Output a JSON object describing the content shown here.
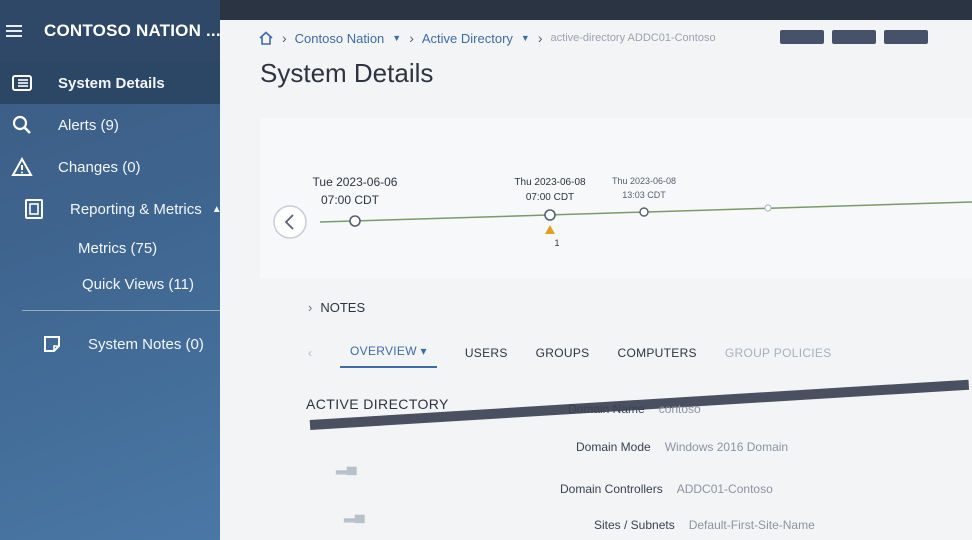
{
  "sidebar": {
    "title": "CONTOSO NATION ...",
    "items": [
      {
        "label": "System Details",
        "icon": "list-icon"
      },
      {
        "label": "Alerts (9)",
        "icon": "search-icon"
      },
      {
        "label": "Changes (0)",
        "icon": "warning-icon"
      },
      {
        "label": "Reporting & Metrics",
        "icon": "report-icon"
      },
      {
        "label": "Metrics (75)"
      },
      {
        "label": "Quick Views (11)"
      },
      {
        "label": "System Notes (0)",
        "icon": "note-icon"
      }
    ]
  },
  "breadcrumb": {
    "level1": "Contoso Nation",
    "level2": "Active Directory",
    "level3": "active-directory ADDC01-Contoso"
  },
  "page_title": "System Details",
  "timeline": {
    "nodes": [
      {
        "day": "Tue 2023-06-06",
        "time": "07:00 CDT"
      },
      {
        "day": "Thu 2023-06-08",
        "time": "07:00 CDT",
        "alert_count": "1"
      },
      {
        "day": "Thu 2023-06-08",
        "time": "13:03 CDT"
      }
    ]
  },
  "notes_label": "NOTES",
  "tabs": [
    "OVERVIEW",
    "USERS",
    "GROUPS",
    "COMPUTERS",
    "GROUP POLICIES"
  ],
  "section_title": "ACTIVE DIRECTORY",
  "details": [
    {
      "key": "Domain Name",
      "value": "contoso"
    },
    {
      "key": "Domain Mode",
      "value": "Windows 2016 Domain"
    },
    {
      "key": "Domain Controllers",
      "value": "ADDC01-Contoso"
    },
    {
      "key": "Sites / Subnets",
      "value": "Default-First-Site-Name"
    }
  ],
  "colors": {
    "accent": "#3f6aa8",
    "sidebar": "#3f6690",
    "alert": "#e0a020"
  }
}
